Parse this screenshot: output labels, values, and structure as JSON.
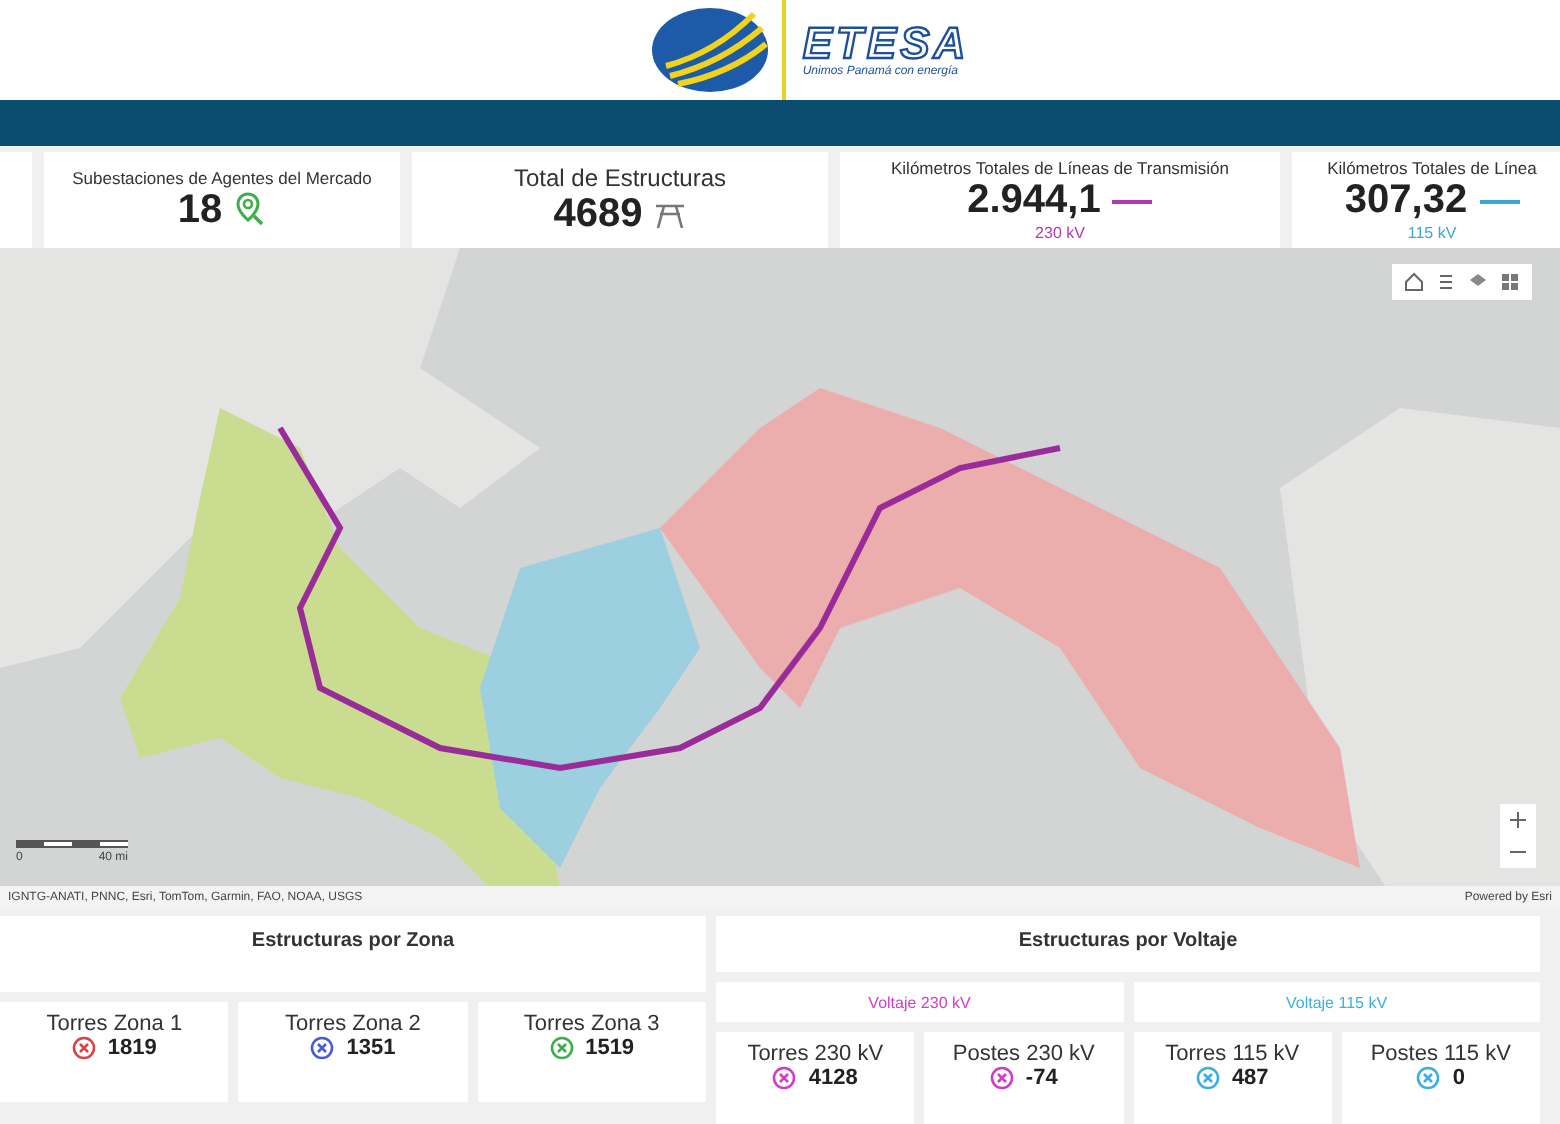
{
  "logo": {
    "name": "ETESA",
    "tagline": "Unimos Panamá con energía"
  },
  "kpis": [
    {
      "title": "Subestaciones de Agentes del Mercado",
      "value": "18",
      "kind": "substations"
    },
    {
      "title": "Total de Estructuras",
      "value": "4689",
      "kind": "structures"
    },
    {
      "title": "Kilómetros Totales de Líneas de Transmisión",
      "value": "2.944,1",
      "kind": "length",
      "sub": "230 kV",
      "color": "#b03ab0"
    },
    {
      "title": "Kilómetros Totales de Línea",
      "value": "307,32",
      "kind": "length",
      "sub": "115 kV",
      "color": "#3aa6d6"
    }
  ],
  "map": {
    "kind": "picture",
    "scale": [
      "0",
      "40 mi"
    ],
    "attribution": "IGNTG-ANATI, PNNC, Esri, TomTom, Garmin, FAO, NOAA, USGS",
    "powered_by": "Powered by Esri"
  },
  "zone_panel": {
    "title": "Estructuras por Zona",
    "items": [
      {
        "label": "Torres Zona 1",
        "value": "1819",
        "color": "#d64545"
      },
      {
        "label": "Torres Zona 2",
        "value": "1351",
        "color": "#4a5bd0"
      },
      {
        "label": "Torres Zona 3",
        "value": "1519",
        "color": "#3fae4a"
      }
    ]
  },
  "voltage_panel": {
    "title": "Estructuras por Voltaje",
    "groups": [
      {
        "label": "Voltaje 230 kV",
        "color": "#d03cc8",
        "items": [
          {
            "label": "Torres 230 kV",
            "value": "4128"
          },
          {
            "label": "Postes 230 kV",
            "value": "-74"
          }
        ]
      },
      {
        "label": "Voltaje 115 kV",
        "color": "#3ab0dc",
        "items": [
          {
            "label": "Torres 115 kV",
            "value": "487"
          },
          {
            "label": "Postes 115 kV",
            "value": "0"
          }
        ]
      }
    ]
  }
}
